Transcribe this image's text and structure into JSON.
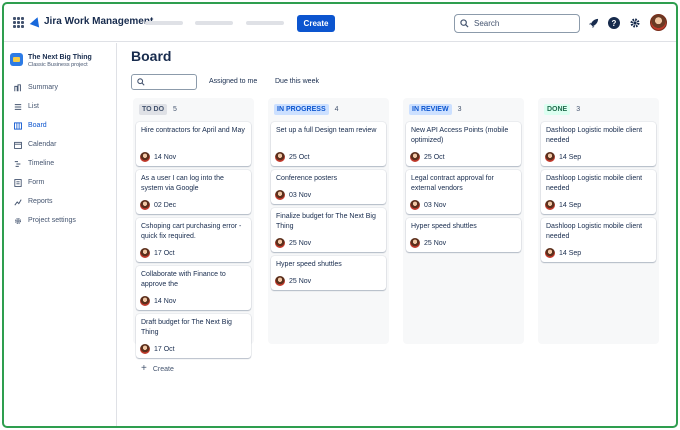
{
  "app": {
    "title": "Jira Work Management"
  },
  "header": {
    "create_label": "Create",
    "search_placeholder": "Search",
    "icons": [
      "apps-grid-icon",
      "rocket-icon",
      "help-icon",
      "gear-icon"
    ],
    "accent": "#0c55cf"
  },
  "sidebar": {
    "project_name": "The Next Big Thing",
    "project_type": "Classic Business project",
    "items": [
      {
        "label": "Summary",
        "icon": "summary-icon",
        "active": false
      },
      {
        "label": "List",
        "icon": "list-icon",
        "active": false
      },
      {
        "label": "Board",
        "icon": "board-icon",
        "active": true
      },
      {
        "label": "Calendar",
        "icon": "calendar-icon",
        "active": false
      },
      {
        "label": "Timeline",
        "icon": "timeline-icon",
        "active": false
      },
      {
        "label": "Form",
        "icon": "form-icon",
        "active": false
      },
      {
        "label": "Reports",
        "icon": "reports-icon",
        "active": false
      },
      {
        "label": "Project settings",
        "icon": "gear-icon",
        "active": false
      }
    ]
  },
  "board": {
    "title": "Board",
    "filters": {
      "assigned": "Assigned to me",
      "due": "Due this week"
    },
    "create_label": "Create",
    "columns": [
      {
        "name": "TO DO",
        "count": "5",
        "lozenge_bg": "#dfe1e6",
        "lozenge_fg": "#44546f",
        "cards": [
          {
            "title": "Hire contractors for April and May",
            "date": "14 Nov"
          },
          {
            "title": "As a user I can log into the system via Google",
            "date": "02 Dec"
          },
          {
            "title": "Cshoping cart purchasing error - quick fix required.",
            "date": "17 Oct"
          },
          {
            "title": "Collaborate with Finance to approve the",
            "date": "14 Nov"
          },
          {
            "title": "Draft budget for The Next Big Thing",
            "date": "17 Oct"
          }
        ]
      },
      {
        "name": "IN PROGRESS",
        "count": "4",
        "lozenge_bg": "#cce0ff",
        "lozenge_fg": "#0c55cf",
        "cards": [
          {
            "title": "Set up a full Design team review",
            "date": "25 Oct"
          },
          {
            "title": "Conference posters",
            "date": "03 Nov"
          },
          {
            "title": "Finalize budget for The Next Big Thing",
            "date": "25 Nov"
          },
          {
            "title": "Hyper speed shuttles",
            "date": "25 Nov"
          }
        ]
      },
      {
        "name": "IN REVIEW",
        "count": "3",
        "lozenge_bg": "#cce0ff",
        "lozenge_fg": "#0c55cf",
        "cards": [
          {
            "title": "New API Access Points (mobile optimized)",
            "date": "25 Oct"
          },
          {
            "title": "Legal contract approval for external vendors",
            "date": "03 Nov"
          },
          {
            "title": "Hyper speed shuttles",
            "date": "25 Nov"
          }
        ]
      },
      {
        "name": "DONE",
        "count": "3",
        "lozenge_bg": "#dcfff1",
        "lozenge_fg": "#216e4e",
        "cards": [
          {
            "title": "Dashloop Logistic mobile client needed",
            "date": "14 Sep"
          },
          {
            "title": "Dashloop Logistic mobile client needed",
            "date": "14 Sep"
          },
          {
            "title": "Dashloop Logistic mobile client needed",
            "date": "14 Sep"
          }
        ]
      }
    ]
  }
}
